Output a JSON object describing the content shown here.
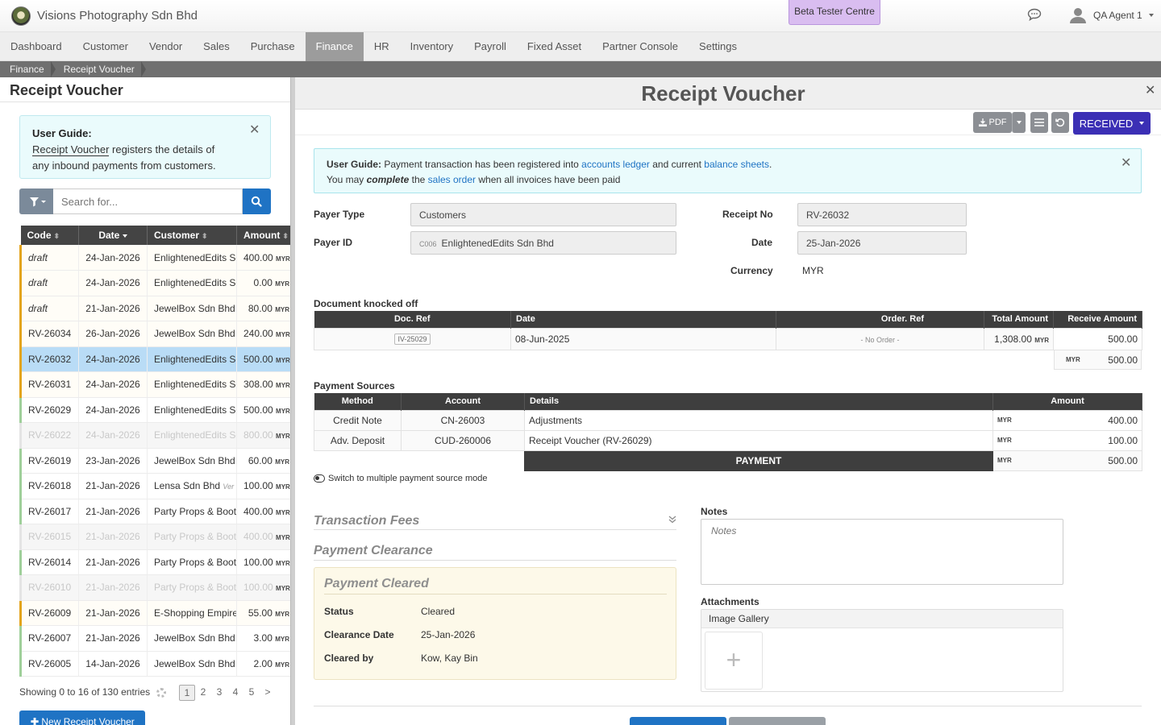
{
  "app": {
    "company": "Visions Photography Sdn Bhd",
    "beta": "Beta Tester Centre",
    "user": "QA Agent 1"
  },
  "nav": [
    "Dashboard",
    "Customer",
    "Vendor",
    "Sales",
    "Purchase",
    "Finance",
    "HR",
    "Inventory",
    "Payroll",
    "Fixed Asset",
    "Partner Console",
    "Settings"
  ],
  "nav_active": "Finance",
  "breadcrumb": [
    "Finance",
    "Receipt Voucher"
  ],
  "left": {
    "title": "Receipt Voucher",
    "guide": {
      "bold": "User Guide:",
      "link": "Receipt Voucher",
      "text1": " registers the details of",
      "text2": "any inbound payments from customers."
    },
    "search_placeholder": "Search for...",
    "columns": {
      "code": "Code",
      "date": "Date",
      "customer": "Customer",
      "amount": "Amount"
    },
    "currency": "MYR",
    "rows": [
      {
        "code": "draft",
        "date": "24-Jan-2026",
        "customer": "EnlightenedEdits Sdn Bhd",
        "amount": "400.00"
      },
      {
        "code": "draft",
        "date": "24-Jan-2026",
        "customer": "EnlightenedEdits Sdn Bhd",
        "amount": "0.00"
      },
      {
        "code": "draft",
        "date": "21-Jan-2026",
        "customer": "JewelBox Sdn Bhd",
        "amount": "80.00"
      },
      {
        "code": "RV-26034",
        "date": "26-Jan-2026",
        "customer": "JewelBox Sdn Bhd",
        "amount": "240.00"
      },
      {
        "code": "RV-26032",
        "date": "24-Jan-2026",
        "customer": "EnlightenedEdits Sdn Bhd",
        "amount": "500.00"
      },
      {
        "code": "RV-26031",
        "date": "24-Jan-2026",
        "customer": "EnlightenedEdits Sdn Bhd",
        "amount": "308.00"
      },
      {
        "code": "RV-26029",
        "date": "24-Jan-2026",
        "customer": "EnlightenedEdits Sdn Bhd",
        "amount": "500.00"
      },
      {
        "code": "RV-26022",
        "date": "24-Jan-2026",
        "customer": "EnlightenedEdits Sdn Bhd",
        "amount": "800.00"
      },
      {
        "code": "RV-26019",
        "date": "23-Jan-2026",
        "customer": "JewelBox Sdn Bhd",
        "amount": "60.00"
      },
      {
        "code": "RV-26018",
        "date": "21-Jan-2026",
        "customer": "Lensa Sdn Bhd",
        "tag": "Ver",
        "amount": "100.00"
      },
      {
        "code": "RV-26017",
        "date": "21-Jan-2026",
        "customer": "Party Props & Booth",
        "amount": "400.00"
      },
      {
        "code": "RV-26015",
        "date": "21-Jan-2026",
        "customer": "Party Props & Booth",
        "amount": "400.00"
      },
      {
        "code": "RV-26014",
        "date": "21-Jan-2026",
        "customer": "Party Props & Booth",
        "amount": "100.00"
      },
      {
        "code": "RV-26010",
        "date": "21-Jan-2026",
        "customer": "Party Props & Booth",
        "amount": "100.00"
      },
      {
        "code": "RV-26009",
        "date": "21-Jan-2026",
        "customer": "E-Shopping Empire",
        "amount": "55.00"
      },
      {
        "code": "RV-26007",
        "date": "21-Jan-2026",
        "customer": "JewelBox Sdn Bhd",
        "amount": "3.00"
      },
      {
        "code": "RV-26005",
        "date": "14-Jan-2026",
        "customer": "JewelBox Sdn Bhd",
        "amount": "2.00"
      }
    ],
    "showing": "Showing 0 to 16 of 130 entries",
    "pages": [
      "1",
      "2",
      "3",
      "4",
      "5",
      ">"
    ],
    "new_button": "New Receipt Voucher"
  },
  "detail": {
    "title": "Receipt Voucher",
    "pdf": "PDF",
    "status": "RECEIVED",
    "guide": {
      "bold": "User Guide:",
      "t1": " Payment transaction has been registered into ",
      "l1": "accounts ledger",
      "t2": " and current ",
      "l2": "balance sheets",
      "t3": ".",
      "t4": "You may ",
      "em": "complete",
      "t5": " the ",
      "l3": "sales order",
      "t6": " when all invoices have been paid"
    },
    "payer_type_label": "Payer Type",
    "payer_type": "Customers",
    "payer_id_label": "Payer ID",
    "payer_id_code": "C006",
    "payer_id": "EnlightenedEdits Sdn Bhd",
    "receipt_no_label": "Receipt No",
    "receipt_no": "RV-26032",
    "date_label": "Date",
    "date": "25-Jan-2026",
    "currency_label": "Currency",
    "currency": "MYR",
    "dko": {
      "title": "Document knocked off",
      "headers": [
        "Doc. Ref",
        "Date",
        "Order. Ref",
        "Total Amount",
        "Receive Amount"
      ],
      "row": {
        "doc": "IV-25029",
        "date": "08-Jun-2025",
        "order": "- No Order -",
        "total": "1,308.00",
        "receive": "500.00"
      },
      "sum_cur": "MYR",
      "sum": "500.00"
    },
    "ps": {
      "title": "Payment Sources",
      "headers": [
        "Method",
        "Account",
        "Details",
        "Amount"
      ],
      "rows": [
        {
          "method": "Credit Note",
          "account": "CN-26003",
          "details": "Adjustments",
          "cur": "MYR",
          "amount": "400.00"
        },
        {
          "method": "Adv. Deposit",
          "account": "CUD-260006",
          "details": "Receipt Voucher (RV-26029)",
          "cur": "MYR",
          "amount": "100.00"
        }
      ],
      "payment_label": "PAYMENT",
      "payment_cur": "MYR",
      "payment_total": "500.00"
    },
    "switch_label": "Switch to multiple payment source mode",
    "fees_title": "Transaction Fees",
    "clearance_title": "Payment Clearance",
    "cleared": {
      "title": "Payment Cleared",
      "status_label": "Status",
      "status": "Cleared",
      "date_label": "Clearance Date",
      "date": "25-Jan-2026",
      "by_label": "Cleared by",
      "by": "Kow, Kay Bin"
    },
    "notes_label": "Notes",
    "notes_placeholder": "Notes",
    "attachments_label": "Attachments",
    "gallery": "Image Gallery",
    "add_glyph": "+"
  },
  "colors": {
    "accent": "#1f73c4",
    "received": "#3b2fb5",
    "beta": "#d9bdf0"
  }
}
